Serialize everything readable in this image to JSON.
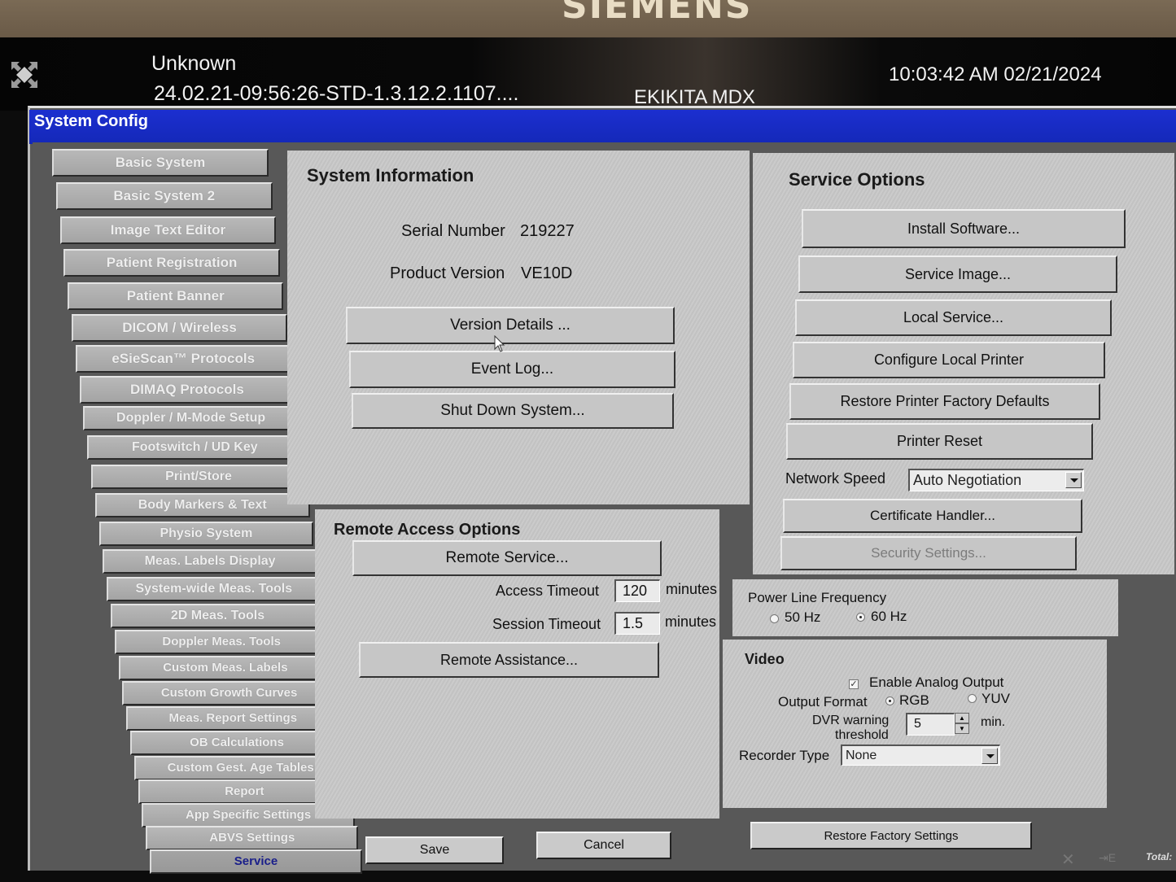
{
  "monitor": {
    "brand": "SIEMENS"
  },
  "header": {
    "patient_name": "Unknown",
    "study_id": "24.02.21-09:56:26-STD-1.3.12.2.1107....",
    "institution": "EKIKITA MDX",
    "datetime": "10:03:42 AM 02/21/2024"
  },
  "window": {
    "title": "System Config"
  },
  "sidebar": {
    "items": [
      {
        "label": "Basic System"
      },
      {
        "label": "Basic System 2"
      },
      {
        "label": "Image Text Editor"
      },
      {
        "label": "Patient Registration"
      },
      {
        "label": "Patient Banner"
      },
      {
        "label": "DICOM / Wireless"
      },
      {
        "label": "eSieScan™ Protocols"
      },
      {
        "label": "DIMAQ Protocols"
      },
      {
        "label": "Doppler / M-Mode Setup"
      },
      {
        "label": "Footswitch / UD Key"
      },
      {
        "label": "Print/Store"
      },
      {
        "label": "Body Markers & Text"
      },
      {
        "label": "Physio System"
      },
      {
        "label": "Meas. Labels Display"
      },
      {
        "label": "System-wide Meas. Tools"
      },
      {
        "label": "2D Meas. Tools"
      },
      {
        "label": "Doppler Meas. Tools"
      },
      {
        "label": "Custom Meas. Labels"
      },
      {
        "label": "Custom Growth Curves"
      },
      {
        "label": "Meas. Report Settings"
      },
      {
        "label": "OB Calculations"
      },
      {
        "label": "Custom Gest. Age Tables"
      },
      {
        "label": "Report"
      },
      {
        "label": "App Specific Settings"
      },
      {
        "label": "ABVS Settings"
      },
      {
        "label": "Service",
        "active": true
      }
    ]
  },
  "system_info": {
    "title": "System Information",
    "serial_label": "Serial Number",
    "serial_value": "219227",
    "version_label": "Product Version",
    "version_value": "VE10D",
    "version_details_btn": "Version Details ...",
    "event_log_btn": "Event Log...",
    "shutdown_btn": "Shut Down System..."
  },
  "remote_access": {
    "title": "Remote Access Options",
    "remote_service_btn": "Remote Service...",
    "access_timeout_label": "Access Timeout",
    "access_timeout_value": "120",
    "access_timeout_unit": "minutes",
    "session_timeout_label": "Session Timeout",
    "session_timeout_value": "1.5",
    "session_timeout_unit": "minutes",
    "remote_assistance_btn": "Remote Assistance..."
  },
  "service_options": {
    "title": "Service Options",
    "buttons": [
      {
        "label": "Install Software..."
      },
      {
        "label": "Service Image..."
      },
      {
        "label": "Local Service..."
      },
      {
        "label": "Configure Local Printer"
      },
      {
        "label": "Restore Printer Factory Defaults"
      },
      {
        "label": "Printer Reset"
      }
    ],
    "network_speed_label": "Network Speed",
    "network_speed_value": "Auto Negotiation",
    "certificate_btn": "Certificate Handler...",
    "security_btn": "Security Settings...",
    "security_enabled": false
  },
  "power_line": {
    "title": "Power Line Frequency",
    "option_50": "50 Hz",
    "option_60": "60 Hz",
    "selected": "60 Hz"
  },
  "video": {
    "title": "Video",
    "enable_analog_label": "Enable Analog Output",
    "enable_analog_checked": true,
    "output_format_label": "Output Format",
    "format_rgb": "RGB",
    "format_yuv": "YUV",
    "format_selected": "RGB",
    "dvr_label_1": "DVR warning",
    "dvr_label_2": "threshold",
    "dvr_value": "5",
    "dvr_unit": "min.",
    "recorder_label": "Recorder Type",
    "recorder_value": "None"
  },
  "footer": {
    "save_btn": "Save",
    "cancel_btn": "Cancel",
    "restore_btn": "Restore Factory Settings",
    "total_label": "Total:"
  },
  "colors": {
    "titlebar": "#1428b8",
    "panel_bg": "#c8c8c8",
    "frame_bg": "#585858",
    "active_nav_text": "#1a1f8a"
  }
}
